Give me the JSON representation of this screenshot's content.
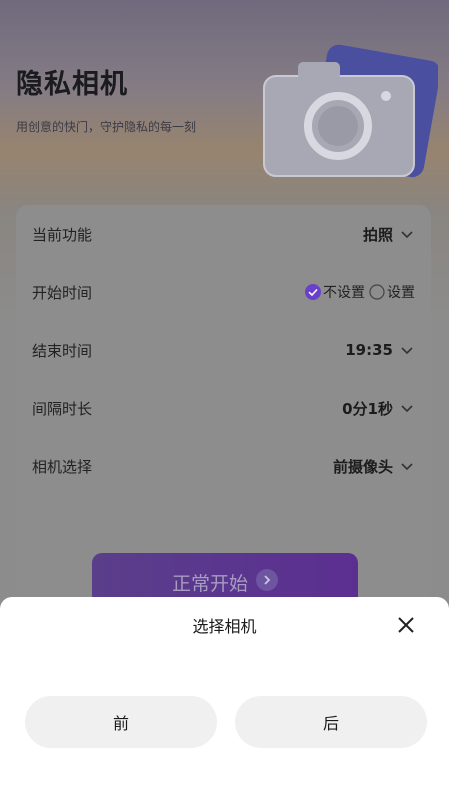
{
  "header": {
    "title": "隐私相机",
    "subtitle": "用创意的快门，守护隐私的每一刻"
  },
  "settings": {
    "function": {
      "label": "当前功能",
      "value": "拍照"
    },
    "start_time": {
      "label": "开始时间",
      "options": [
        {
          "label": "不设置",
          "checked": true
        },
        {
          "label": "设置",
          "checked": false
        }
      ]
    },
    "end_time": {
      "label": "结束时间",
      "value": "19:35"
    },
    "interval": {
      "label": "间隔时长",
      "value": "0分1秒"
    },
    "camera": {
      "label": "相机选择",
      "value": "前摄像头"
    }
  },
  "start_button": {
    "label": "正常开始"
  },
  "sheet": {
    "title": "选择相机",
    "options": [
      {
        "label": "前"
      },
      {
        "label": "后"
      }
    ]
  },
  "colors": {
    "accent": "#6a3fc9",
    "button": "#5a3e8a",
    "sheet_bg": "#ffffff",
    "option_bg": "#f0f0f0"
  },
  "icons": [
    "camera-illustration",
    "chevron-down-icon",
    "check-circle-icon",
    "radio-empty-icon",
    "arrow-right-icon",
    "close-icon"
  ]
}
